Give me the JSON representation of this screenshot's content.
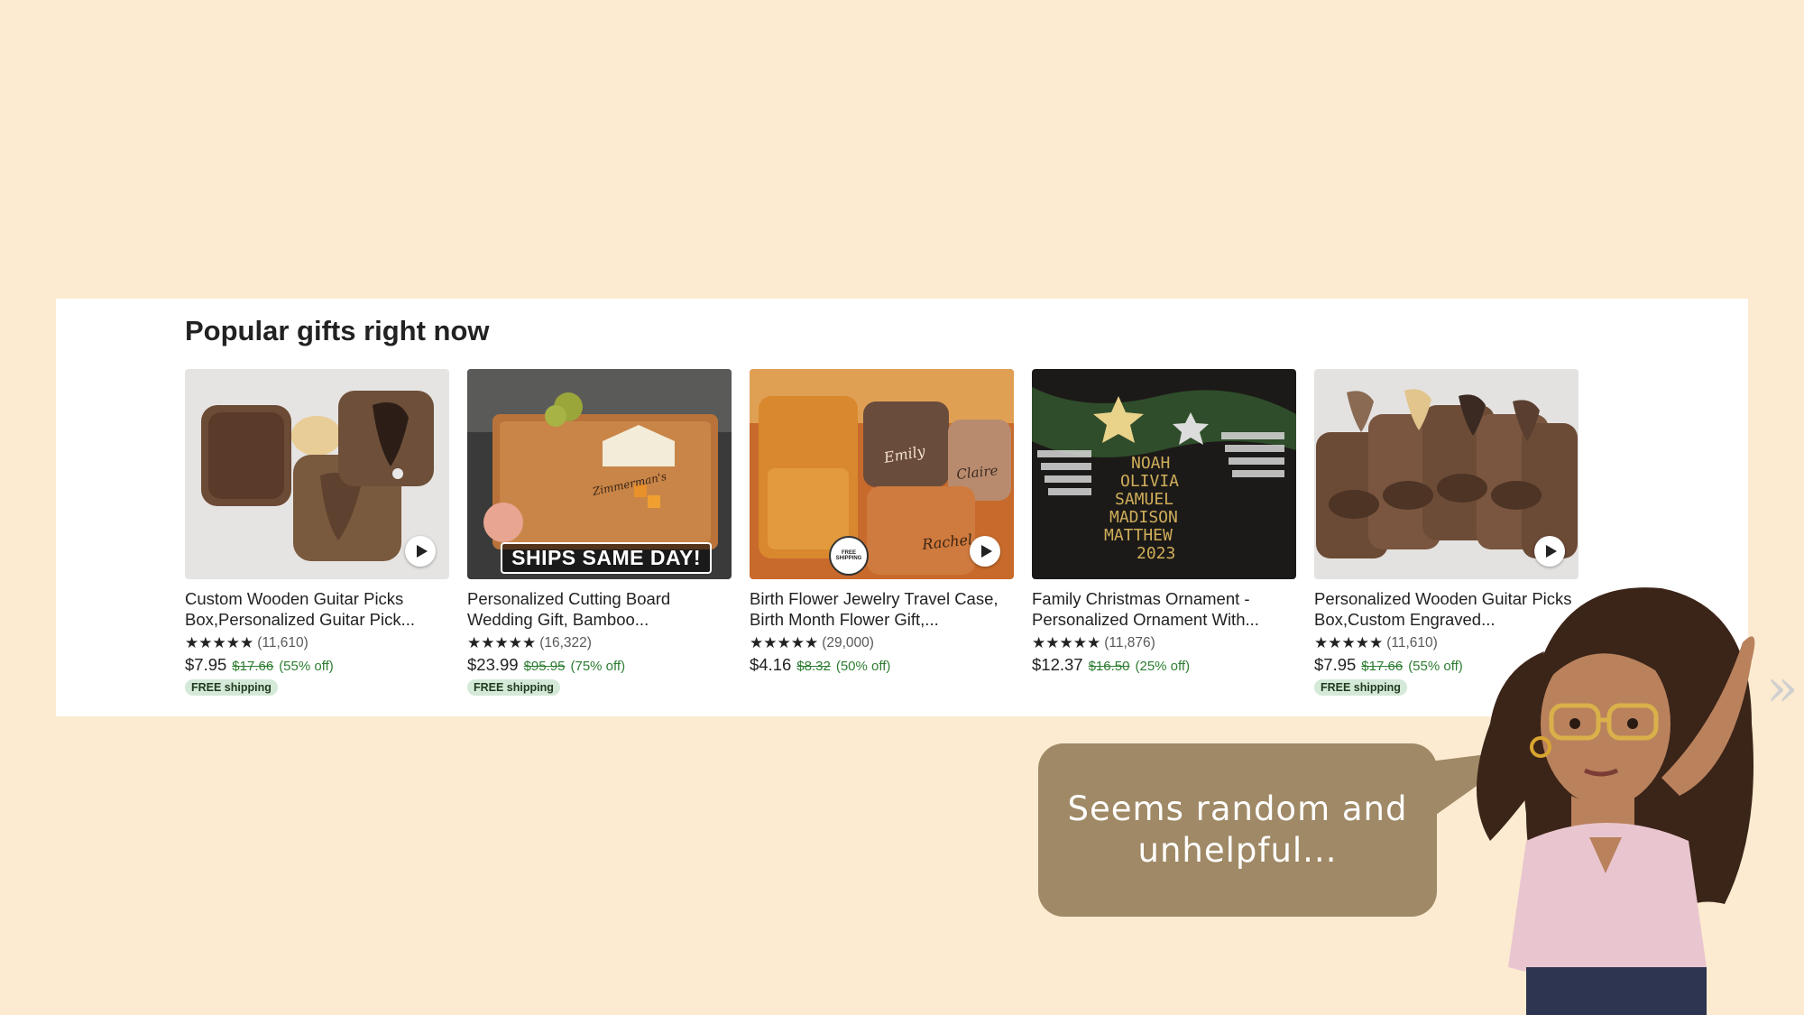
{
  "section": {
    "title": "Popular gifts right now"
  },
  "products": [
    {
      "title": "Custom Wooden Guitar Picks Box,Personalized Guitar Pick...",
      "stars": "★★★★★",
      "reviews": "(11,610)",
      "price": "$7.95",
      "original_price": "$17.66",
      "discount": "(55% off)",
      "shipping": "FREE shipping",
      "rating_fraction": 1.0
    },
    {
      "title": "Personalized Cutting Board Wedding Gift, Bamboo...",
      "stars": "★★★★★",
      "reviews": "(16,322)",
      "price": "$23.99",
      "original_price": "$95.95",
      "discount": "(75% off)",
      "shipping": "FREE shipping",
      "badge": "SHIPS SAME DAY!",
      "rating_fraction": 1.0
    },
    {
      "title": "Birth Flower Jewelry Travel Case, Birth Month Flower Gift,...",
      "stars": "★★★★★",
      "reviews": "(29,000)",
      "price": "$4.16",
      "original_price": "$8.32",
      "discount": "(50% off)",
      "seal": "FREE SHIPPING",
      "names": [
        "Emily",
        "Claire",
        "Rachel"
      ],
      "rating_fraction": 1.0
    },
    {
      "title": "Family Christmas Ornament - Personalized Ornament With...",
      "stars": "★★★★★",
      "reviews": "(11,876)",
      "price": "$12.37",
      "original_price": "$16.50",
      "discount": "(25% off)",
      "ornament_text": [
        "NOAH",
        "OLIVIA",
        "SAMUEL",
        "MADISON",
        "MATTHEW",
        "2023"
      ],
      "rating_fraction": 1.0
    },
    {
      "title": "Personalized Wooden Guitar Picks Box,Custom Engraved...",
      "stars": "★★★★★",
      "reviews": "(11,610)",
      "price": "$7.95",
      "original_price": "$17.66",
      "discount": "(55% off)",
      "shipping": "FREE shipping",
      "rating_fraction": 1.0
    }
  ],
  "bubble": {
    "text": "Seems random and unhelpful..."
  },
  "colors": {
    "background": "#fcebd1",
    "bubble": "#a08966",
    "discount_green": "#2e7d32",
    "shipping_badge": "#d4e9d7"
  },
  "icons": [
    "play-icon",
    "avatar-illustration"
  ]
}
